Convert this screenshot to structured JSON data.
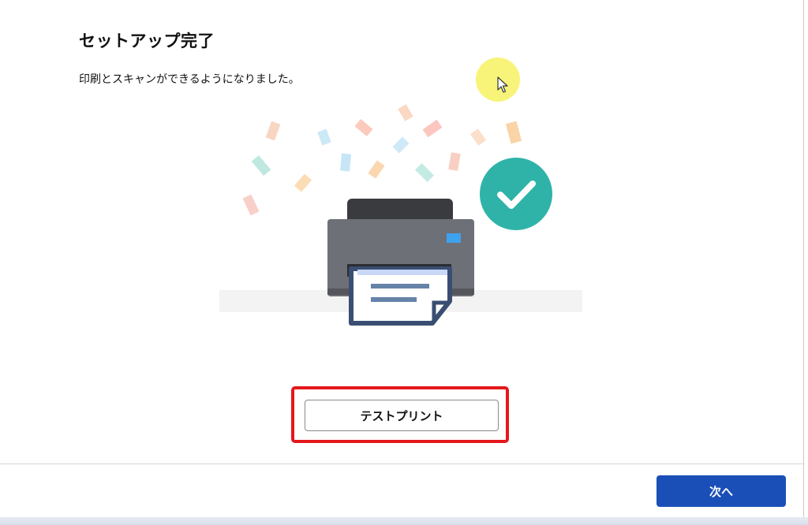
{
  "dialog": {
    "title": "セットアップ完了",
    "subtitle": "印刷とスキャンができるようになりました。"
  },
  "actions": {
    "test_print_label": "テストプリント",
    "next_label": "次へ"
  },
  "illustration": {
    "printer_icon": "printer-icon",
    "check_icon": "checkmark-icon",
    "confetti_icon": "confetti-icon",
    "check_color": "#2fb3a8",
    "printer_color": "#6e7078"
  },
  "colors": {
    "primary_button": "#1a4fb8",
    "highlight_box": "#e5171b",
    "cursor_highlight": "#f6f36a"
  }
}
